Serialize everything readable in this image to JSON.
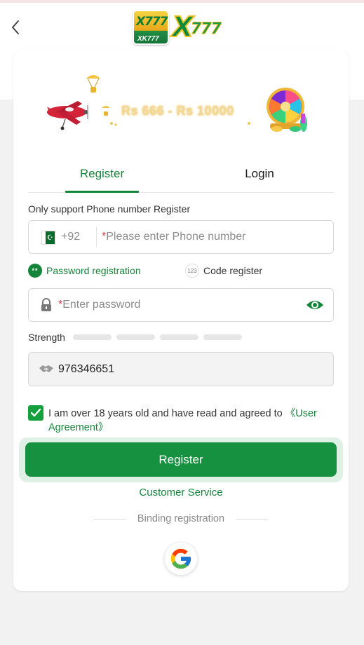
{
  "header": {
    "logo": {
      "badge_text_top": "X777",
      "badge_text_bottom": "XK777",
      "main_x": "X",
      "main_num": "777"
    },
    "back_icon": "chevron-left-icon"
  },
  "banner": {
    "amount_text": "Rs 666 - Rs 10000"
  },
  "tabs": {
    "register": "Register",
    "login": "Login",
    "active": "register"
  },
  "form": {
    "hint": "Only support Phone number Register",
    "phone": {
      "country_code": "+92",
      "required_mark": "*",
      "placeholder": "Please enter Phone number",
      "flag": "pakistan-flag-icon"
    },
    "modes": {
      "password_icon_text": "**",
      "password_label": "Password registration",
      "code_icon_text": "123",
      "code_label": "Code register",
      "active": "password"
    },
    "password": {
      "required_mark": "*",
      "placeholder": "Enter password"
    },
    "strength_label": "Strength",
    "strength_segments": 4,
    "invite": {
      "value": "976346651"
    },
    "agreement": {
      "checked": true,
      "text": "I am over 18 years old and have read and agreed to ",
      "link": "《User Agreement》"
    },
    "submit_label": "Register"
  },
  "footer": {
    "customer_service": "Customer Service",
    "binding_label": "Binding registration",
    "google_icon": "google-icon"
  },
  "colors": {
    "brand_green": "#15843b",
    "button_green": "#15913f",
    "required_red": "#d9363e"
  }
}
